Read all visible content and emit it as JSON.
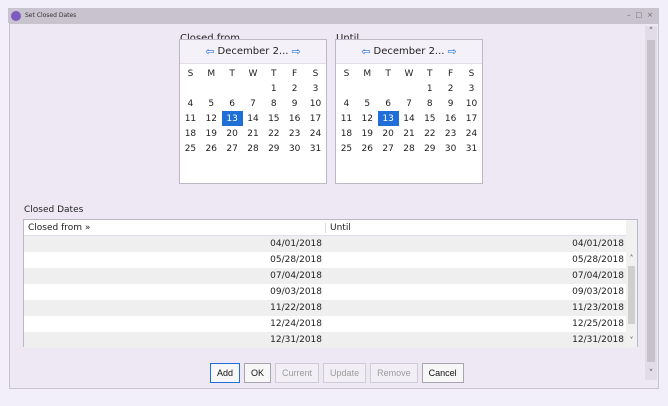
{
  "window": {
    "title": "Set Closed Dates",
    "controls": [
      "–",
      "□",
      "×"
    ]
  },
  "calendars": {
    "from": {
      "label": "Closed from",
      "month": "December 2...",
      "weekdays": [
        "S",
        "M",
        "T",
        "W",
        "T",
        "F",
        "S"
      ],
      "weeks": [
        [
          "",
          "",
          "",
          "",
          "1",
          "2",
          "3"
        ],
        [
          "4",
          "5",
          "6",
          "7",
          "8",
          "9",
          "10"
        ],
        [
          "11",
          "12",
          "13",
          "14",
          "15",
          "16",
          "17"
        ],
        [
          "18",
          "19",
          "20",
          "21",
          "22",
          "23",
          "24"
        ],
        [
          "25",
          "26",
          "27",
          "28",
          "29",
          "30",
          "31"
        ]
      ]
    },
    "until": {
      "label": "Until",
      "month": "December 2...",
      "weekdays": [
        "S",
        "M",
        "T",
        "W",
        "T",
        "F",
        "S"
      ],
      "weeks": [
        [
          "",
          "",
          "",
          "",
          "1",
          "2",
          "3"
        ],
        [
          "4",
          "5",
          "6",
          "7",
          "8",
          "9",
          "10"
        ],
        [
          "11",
          "12",
          "13",
          "14",
          "15",
          "16",
          "17"
        ],
        [
          "18",
          "19",
          "20",
          "21",
          "22",
          "23",
          "24"
        ],
        [
          "25",
          "26",
          "27",
          "28",
          "29",
          "30",
          "31"
        ]
      ]
    }
  },
  "closed_dates": {
    "label": "Closed Dates",
    "columns": [
      "Closed from »",
      "Until"
    ],
    "rows": [
      [
        "04/01/2018",
        "04/01/2018"
      ],
      [
        "05/28/2018",
        "05/28/2018"
      ],
      [
        "07/04/2018",
        "07/04/2018"
      ],
      [
        "09/03/2018",
        "09/03/2018"
      ],
      [
        "11/22/2018",
        "11/23/2018"
      ],
      [
        "12/24/2018",
        "12/25/2018"
      ],
      [
        "12/31/2018",
        "12/31/2018"
      ]
    ]
  },
  "buttons": {
    "add": "Add",
    "ok": "OK",
    "current": "Current",
    "update": "Update",
    "remove": "Remove",
    "cancel": "Cancel"
  },
  "icons": {
    "nav_prev": "arrow-left",
    "nav_next": "arrow-right",
    "scroll_up": "chevron-up",
    "scroll_down": "chevron-down"
  },
  "colors": {
    "accent": "#1f6fd6",
    "dialog_bg": "#ede8f4",
    "app_icon": "#7b5bbf"
  }
}
